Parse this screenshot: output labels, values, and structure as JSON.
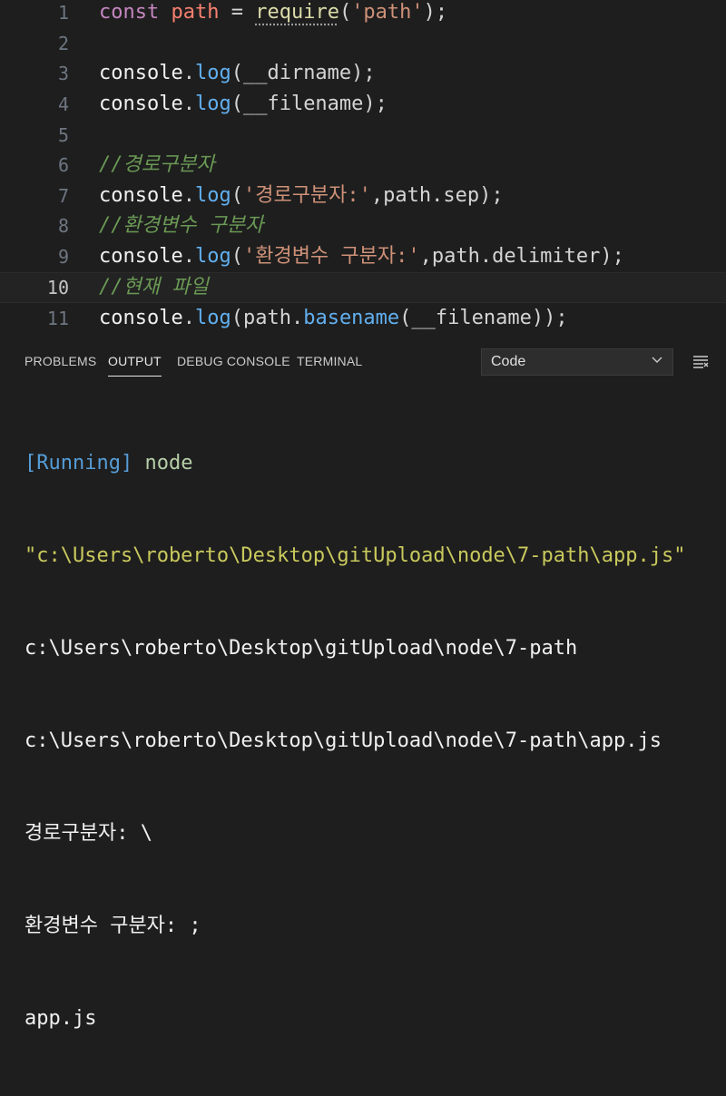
{
  "editor": {
    "lines": [
      {
        "num": "1"
      },
      {
        "num": "2"
      },
      {
        "num": "3"
      },
      {
        "num": "4"
      },
      {
        "num": "5"
      },
      {
        "num": "6"
      },
      {
        "num": "7"
      },
      {
        "num": "8"
      },
      {
        "num": "9"
      },
      {
        "num": "10"
      },
      {
        "num": "11"
      }
    ],
    "tokens": {
      "const": "const",
      "path": "path",
      "eq": " = ",
      "require": "require",
      "lp": "(",
      "path_str": "'path'",
      "rp_semi": ");",
      "console": "console",
      "dot": ".",
      "log": "log",
      "dirname": "(__dirname);",
      "filename": "(__filename);",
      "cmt_sep": "//경로구분자",
      "sep_str": "'경로구분자:'",
      "sep_rest": ",path.sep);",
      "cmt_delim": "//환경변수 구분자",
      "delim_str": "'환경변수 구분자:'",
      "delim_rest": ",path.delimiter);",
      "cmt_file": "//현재 파일",
      "base_open": "(path.",
      "basename": "basename",
      "base_rest": "(__filename));"
    },
    "active_line": "10"
  },
  "panel": {
    "tabs": [
      {
        "label": "PROBLEMS"
      },
      {
        "label": "OUTPUT"
      },
      {
        "label": "DEBUG CONSOLE"
      },
      {
        "label": "TERMINAL"
      }
    ],
    "active_tab": "OUTPUT",
    "channel_select": "Code",
    "output": {
      "running": "[Running]",
      "cmd": " node",
      "cmd_path": "\"c:\\Users\\roberto\\Desktop\\gitUpload\\node\\7-path\\app.js\"",
      "line_dirname": "c:\\Users\\roberto\\Desktop\\gitUpload\\node\\7-path",
      "line_filename": "c:\\Users\\roberto\\Desktop\\gitUpload\\node\\7-path\\app.js",
      "line_sep": "경로구분자: \\",
      "line_delim": "환경변수 구분자: ;",
      "line_base": "app.js"
    }
  },
  "colors": {
    "background": "#1e1e1e",
    "keyword": "#c586c0",
    "variable": "#f88070",
    "function": "#dcdcaa",
    "string": "#ce9178",
    "method": "#61afef",
    "comment": "#6a9955",
    "running": "#569cd6"
  }
}
